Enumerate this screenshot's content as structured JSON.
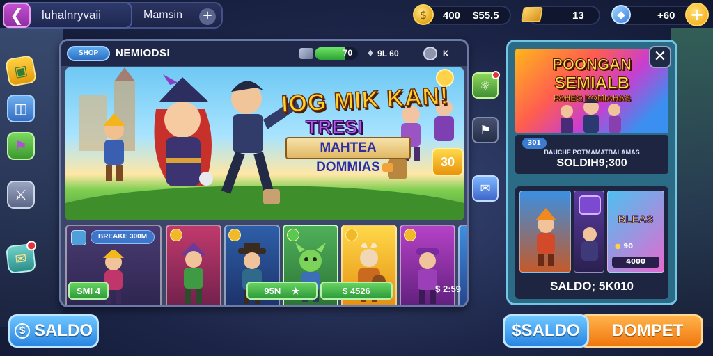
{
  "topbar": {
    "profile_name": "luhalnryvaii",
    "tab_name": "Mamsin",
    "resources": [
      {
        "name": "coins",
        "value": "400"
      },
      {
        "name": "cash",
        "value": "$55.5"
      },
      {
        "name": "gold",
        "value": "13"
      },
      {
        "name": "gems",
        "value": "+60"
      }
    ]
  },
  "main": {
    "shop_chip": "SHOP",
    "title": "NEMIODSI",
    "head_resources": [
      {
        "name": "energy",
        "value": "70",
        "fill": 0.7
      },
      {
        "name": "keys",
        "value": "9L 60"
      },
      {
        "name": "tickets",
        "value": "K"
      }
    ],
    "banner": {
      "title": "IOG MIK KAN!",
      "subtitle": "TRESI",
      "ribbon": "MAHTEA DOMMIAS",
      "badge": "30"
    },
    "strip_label": "BREAKE 300M",
    "buttons": {
      "left": "SMI 4",
      "middle": "95N",
      "right": "$ 4526"
    },
    "price": "$ 2:59"
  },
  "promo": {
    "title_line1": "POONGAN",
    "title_line2": "SEMIALB",
    "title_line3": "PAHEO DOMIAHAS",
    "chip": "301",
    "desc": "BAUCHE POTMAMATBALAMAS",
    "price": "SOLDIH9;300",
    "card_title": "BLEAS",
    "card_price1": "90",
    "card_price2": "4000",
    "saldo": "SALDO; 5K010"
  },
  "bottom": {
    "saldo_left": "SALDO",
    "saldo_right": "SALDO",
    "dompet": "DOMPET"
  },
  "colors": {
    "accent_blue": "#2a86e2",
    "accent_orange": "#f0780f",
    "panel_border": "#6b7aa8",
    "promo_border": "#73c6e6"
  }
}
